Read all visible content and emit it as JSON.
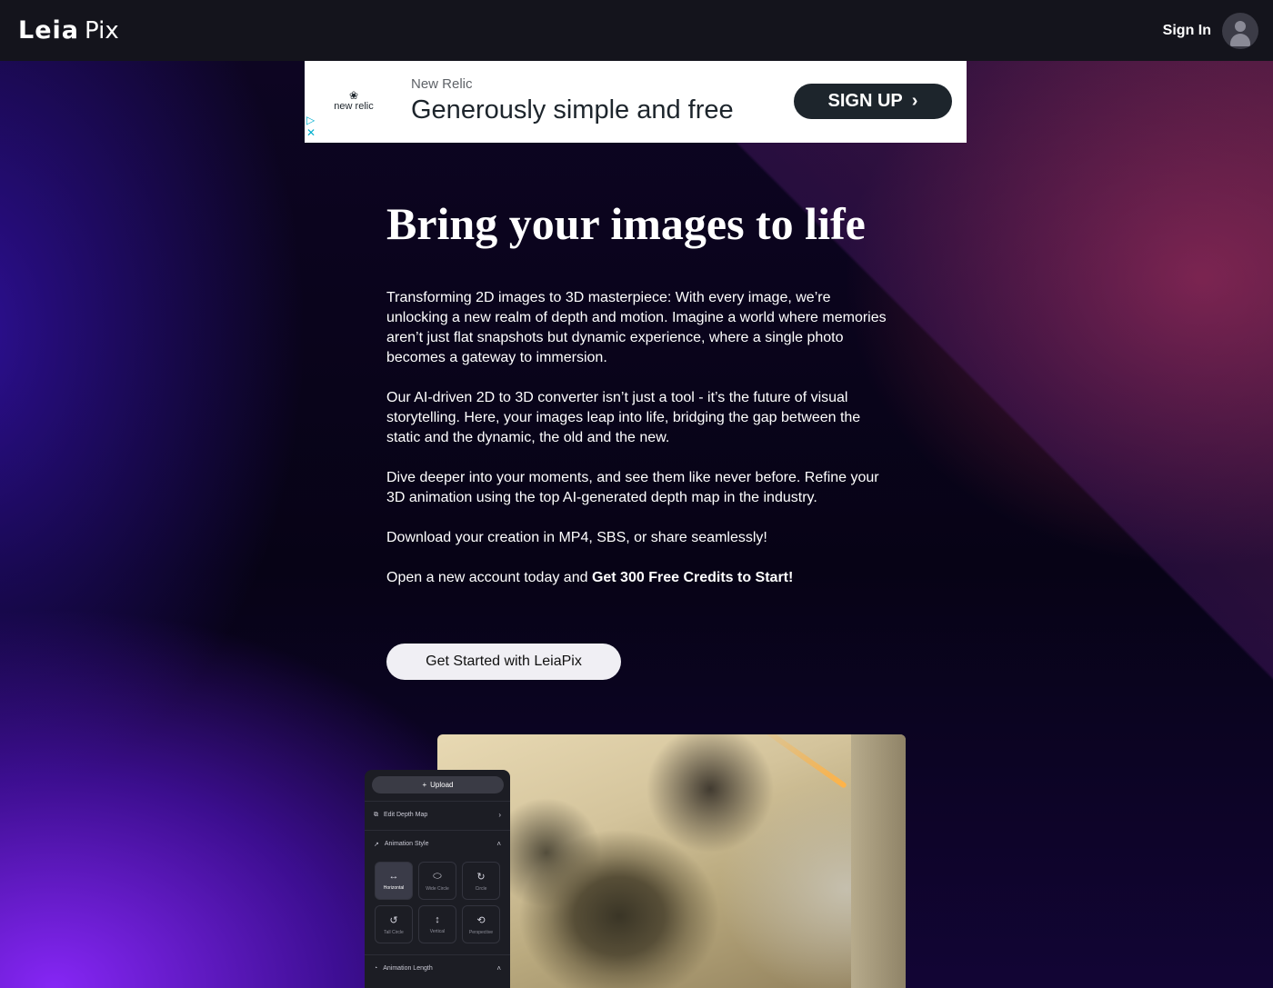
{
  "header": {
    "logo_primary": "Leia",
    "logo_secondary": "Pix",
    "sign_in": "Sign In"
  },
  "ad": {
    "logo_mark": "❀",
    "logo_text": "new relic",
    "advertiser": "New Relic",
    "headline": "Generously simple and free",
    "cta": "SIGN UP",
    "cta_icon": "›",
    "adchoices_play": "▷",
    "adchoices_close": "✕"
  },
  "hero": {
    "title": "Bring your images to life",
    "paragraphs": [
      "Transforming 2D images to 3D masterpiece: With every image, we’re unlocking a new realm of depth and motion. Imagine a world where memories aren’t just flat snapshots but dynamic experience, where a single photo becomes a gateway to immersion.",
      "Our AI-driven 2D to 3D converter isn’t just a tool - it’s the future of visual storytelling. Here, your images leap into life, bridging the gap between the static and the dynamic, the old and the new.",
      "Dive deeper into your moments, and see them like never before. Refine your 3D animation using the top AI-generated depth map in the industry.",
      "Download your creation in MP4, SBS, or share seamlessly!"
    ],
    "offer_prefix": "Open a new account today and ",
    "offer_bold": "Get 300 Free Credits to Start!",
    "cta": "Get Started with LeiaPix"
  },
  "editor_panel": {
    "upload": "Upload",
    "upload_icon": "+",
    "edit_depth_map": "Edit Depth Map",
    "animation_style": "Animation Style",
    "animation_length": "Animation Length",
    "styles": [
      {
        "label": "Horizontal",
        "icon": "↔"
      },
      {
        "label": "Wide Circle",
        "icon": "⬭"
      },
      {
        "label": "Circle",
        "icon": "↻"
      },
      {
        "label": "Tall Circle",
        "icon": "↺"
      },
      {
        "label": "Vertical",
        "icon": "↕"
      },
      {
        "label": "Perspective",
        "icon": "⟲"
      }
    ]
  },
  "colors": {
    "header_bg": "#14141c",
    "ad_cta_bg": "#1d252c",
    "cta_bg": "#f0eff4",
    "accent_purple": "#8c28ff"
  }
}
